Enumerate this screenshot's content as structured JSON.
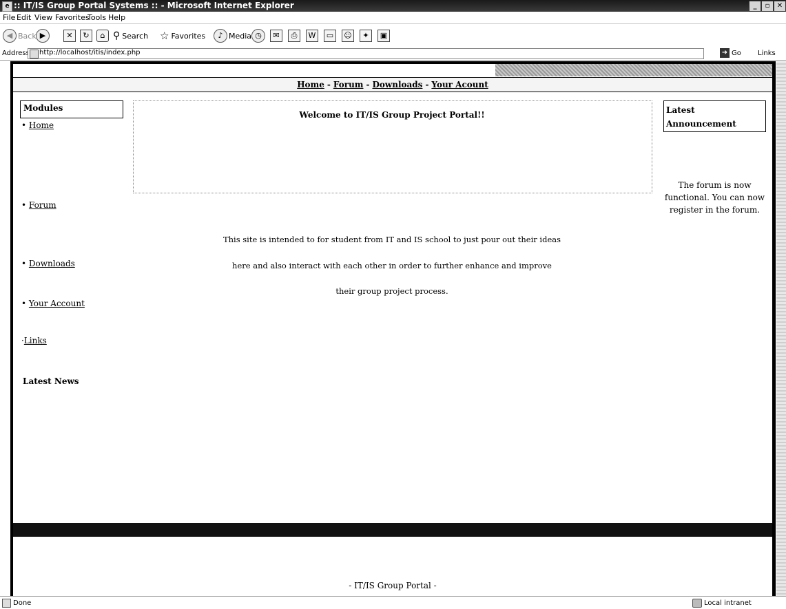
{
  "window": {
    "title": ":: IT/IS Group Portal Systems :: - Microsoft Internet Explorer"
  },
  "menu": [
    "File",
    "Edit",
    "View",
    "Favorites",
    "Tools",
    "Help"
  ],
  "toolbar": {
    "back": "Back",
    "search": "Search",
    "favorites": "Favorites",
    "media": "Media"
  },
  "address": {
    "label": "Address",
    "url": "http://localhost/itis/index.php",
    "go": "Go",
    "links": "Links"
  },
  "nav": {
    "home": "Home",
    "forum": "Forum",
    "downloads": "Downloads",
    "account": "Your Acount"
  },
  "modules": {
    "title": "Modules",
    "items": [
      {
        "label": "Home"
      },
      {
        "label": "Forum"
      },
      {
        "label": "Downloads"
      },
      {
        "label": "Your Account"
      },
      {
        "label": "Links"
      }
    ],
    "latest_news": "Latest News"
  },
  "main": {
    "welcome": "Welcome to IT/IS Group Project Portal!!",
    "body_lines": [
      "This site is intended to for student from IT and IS school to just pour out their ideas",
      "here and also interact with each other in order to further enhance and improve",
      "their group project process."
    ]
  },
  "announcement": {
    "title": "Latest Announcement",
    "text": "The forum is now functional. You can now register in the forum."
  },
  "footer": {
    "text": "- IT/IS Group Portal -"
  },
  "status": {
    "left": "Done",
    "zone": "Local intranet"
  }
}
